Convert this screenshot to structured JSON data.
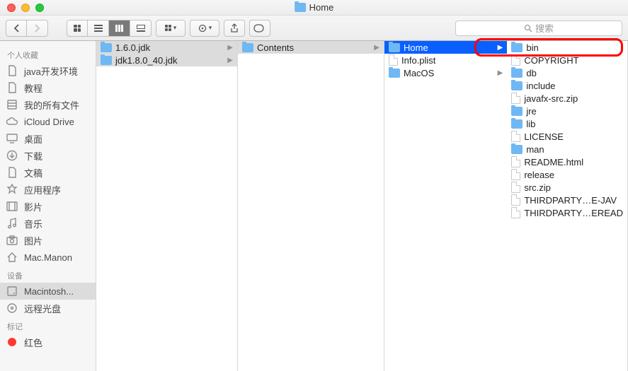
{
  "window": {
    "title": "Home"
  },
  "search": {
    "placeholder": "搜索"
  },
  "sidebar": {
    "sections": [
      {
        "header": "个人收藏",
        "items": [
          {
            "label": "java开发环境",
            "icon": "doc"
          },
          {
            "label": "教程",
            "icon": "doc"
          },
          {
            "label": "我的所有文件",
            "icon": "all"
          },
          {
            "label": "iCloud Drive",
            "icon": "cloud"
          },
          {
            "label": "桌面",
            "icon": "desktop"
          },
          {
            "label": "下载",
            "icon": "download"
          },
          {
            "label": "文稿",
            "icon": "doc"
          },
          {
            "label": "应用程序",
            "icon": "apps"
          },
          {
            "label": "影片",
            "icon": "movie"
          },
          {
            "label": "音乐",
            "icon": "music"
          },
          {
            "label": "图片",
            "icon": "photo"
          },
          {
            "label": "Mac.Manon",
            "icon": "home"
          }
        ]
      },
      {
        "header": "设备",
        "items": [
          {
            "label": "Macintosh...",
            "icon": "disk",
            "selected": true
          },
          {
            "label": "远程光盘",
            "icon": "disc"
          }
        ]
      },
      {
        "header": "标记",
        "items": [
          {
            "label": "红色",
            "icon": "tag-red"
          }
        ]
      }
    ]
  },
  "columns": [
    [
      {
        "label": "1.6.0.jdk",
        "type": "folder",
        "selected": true,
        "arrow": true
      },
      {
        "label": "jdk1.8.0_40.jdk",
        "type": "folder",
        "selected": true,
        "arrow": true
      }
    ],
    [
      {
        "label": "Contents",
        "type": "folder",
        "selected": true,
        "arrow": true
      }
    ],
    [
      {
        "label": "Home",
        "type": "folder",
        "selected": "blue",
        "arrow": true
      },
      {
        "label": "Info.plist",
        "type": "doc"
      },
      {
        "label": "MacOS",
        "type": "folder",
        "arrow": true
      }
    ],
    [
      {
        "label": "bin",
        "type": "folder"
      },
      {
        "label": "COPYRIGHT",
        "type": "doc"
      },
      {
        "label": "db",
        "type": "folder"
      },
      {
        "label": "include",
        "type": "folder"
      },
      {
        "label": "javafx-src.zip",
        "type": "doc"
      },
      {
        "label": "jre",
        "type": "folder"
      },
      {
        "label": "lib",
        "type": "folder"
      },
      {
        "label": "LICENSE",
        "type": "doc"
      },
      {
        "label": "man",
        "type": "folder"
      },
      {
        "label": "README.html",
        "type": "doc"
      },
      {
        "label": "release",
        "type": "doc"
      },
      {
        "label": "src.zip",
        "type": "doc"
      },
      {
        "label": "THIRDPARTY…E-JAV",
        "type": "doc"
      },
      {
        "label": "THIRDPARTY…EREAD",
        "type": "doc"
      }
    ]
  ]
}
